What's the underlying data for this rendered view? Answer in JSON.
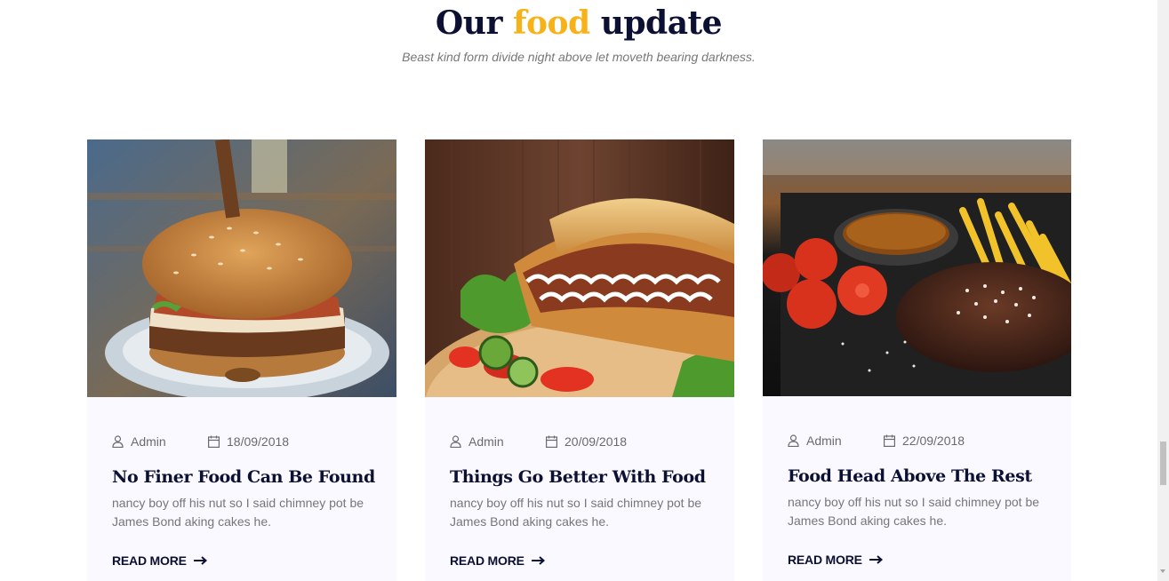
{
  "section": {
    "title_before": "Our",
    "title_accent": "food",
    "title_after": "update",
    "subtitle": "Beast kind form divide night above let moveth bearing darkness."
  },
  "colors": {
    "heading": "#0c1033",
    "accent": "#f7b21a",
    "body_text": "#777777",
    "card_bg": "#f9f9ff"
  },
  "posts": [
    {
      "image": "burger-photo",
      "author_icon": "user-icon",
      "author": "Admin",
      "date_icon": "calendar-icon",
      "date": "18/09/2018",
      "title": "No Finer Food Can Be Found",
      "excerpt": "nancy boy off his nut so I said chimney pot be James Bond aking cakes he.",
      "cta": "READ MORE",
      "cta_icon": "arrow-right-icon"
    },
    {
      "image": "sandwich-photo",
      "author_icon": "user-icon",
      "author": "Admin",
      "date_icon": "calendar-icon",
      "date": "20/09/2018",
      "title": "Things Go Better With Food",
      "excerpt": "nancy boy off his nut so I said chimney pot be James Bond aking cakes he.",
      "cta": "READ MORE",
      "cta_icon": "arrow-right-icon"
    },
    {
      "image": "steak-photo",
      "author_icon": "user-icon",
      "author": "Admin",
      "date_icon": "calendar-icon",
      "date": "22/09/2018",
      "title": "Food Head Above The Rest",
      "excerpt": "nancy boy off his nut so I said chimney pot be James Bond aking cakes he.",
      "cta": "READ MORE",
      "cta_icon": "arrow-right-icon"
    }
  ]
}
